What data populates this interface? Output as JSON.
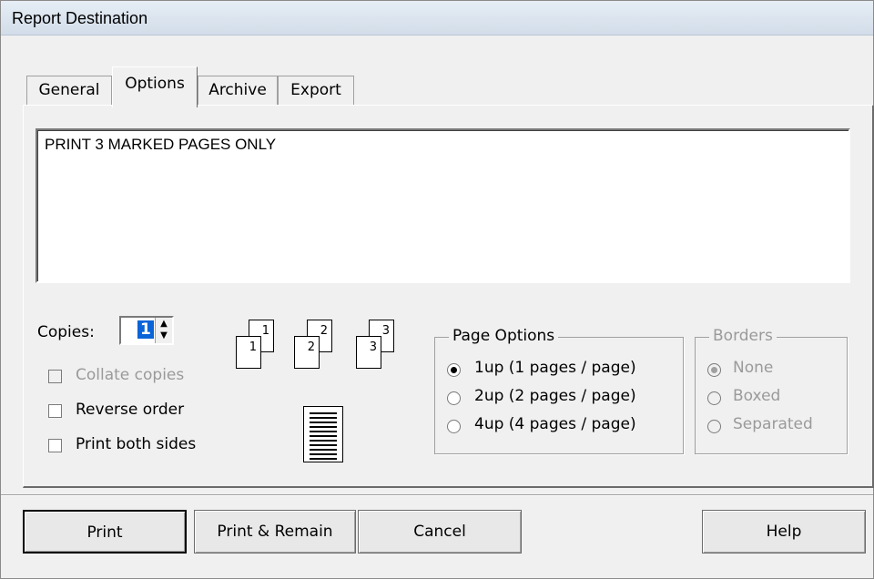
{
  "window": {
    "title": "Report Destination"
  },
  "tabs": [
    {
      "label": "General"
    },
    {
      "label": "Options"
    },
    {
      "label": "Archive"
    },
    {
      "label": "Export"
    }
  ],
  "message_text": "PRINT 3 MARKED PAGES ONLY",
  "copies": {
    "label": "Copies:",
    "value": "1"
  },
  "checkboxes": {
    "collate": "Collate copies",
    "reverse": "Reverse order",
    "both_sides": "Print both sides"
  },
  "collate_icons": [
    {
      "page_a": "1",
      "page_b": "1"
    },
    {
      "page_a": "2",
      "page_b": "2"
    },
    {
      "page_a": "3",
      "page_b": "3"
    }
  ],
  "page_options": {
    "legend": "Page Options",
    "options": [
      "1up (1 pages / page)",
      "2up (2 pages / page)",
      "4up (4 pages / page)"
    ],
    "selected": "1up (1 pages / page)"
  },
  "borders": {
    "legend": "Borders",
    "options": [
      "None",
      "Boxed",
      "Separated"
    ],
    "selected": "None"
  },
  "buttons": {
    "print": "Print",
    "print_remain": "Print & Remain",
    "cancel": "Cancel",
    "help": "Help"
  }
}
